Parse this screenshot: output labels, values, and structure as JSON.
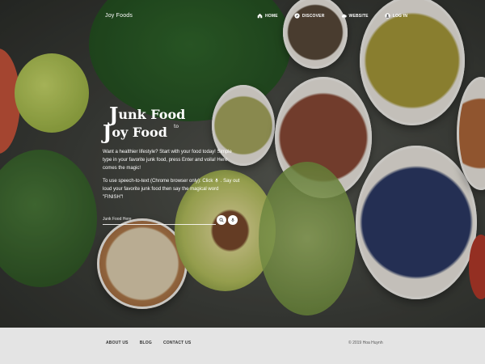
{
  "brand": "Joy Foods",
  "nav": [
    {
      "label": "HOME",
      "icon": "home-icon"
    },
    {
      "label": "DISCOVER",
      "icon": "compass-icon"
    },
    {
      "label": "WEBSITE",
      "icon": "cloud-icon"
    },
    {
      "label": "LOG IN",
      "icon": "user-icon"
    }
  ],
  "hero": {
    "title_line1_first": "J",
    "title_line1_rest": "unk Food",
    "title_line2_first": "J",
    "title_line2_rest": "oy Food",
    "title_to": "to",
    "desc1": "Want a healthier lifestyle? Start with your food today! Simple type in your favorite junk food, press Enter and voila! Here comes the magic!",
    "desc2_a": "To use speech-to-text (Chrome browser only): Click",
    "desc2_b": ". Say out loud your favorite junk food then say the magical word \"FINISH\"!"
  },
  "search": {
    "placeholder": "Junk Food Here"
  },
  "footer": {
    "links": [
      "ABOUT US",
      "BLOG",
      "CONTACT US"
    ],
    "copyright": "© 2019 Hoa Huynh"
  }
}
